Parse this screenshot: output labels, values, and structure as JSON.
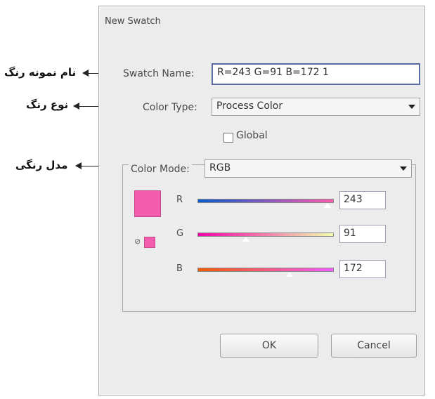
{
  "dialog": {
    "title": "New Swatch",
    "swatch_name_label": "Swatch Name:",
    "swatch_name_value": "R=243 G=91 B=172 1",
    "color_type_label": "Color Type:",
    "color_type_value": "Process Color",
    "global_label": "Global",
    "global_checked": false,
    "color_mode_label": "Color Mode:",
    "color_mode_value": "RGB",
    "swatch_color": "#f35bac",
    "sliders": [
      {
        "label": "R",
        "value": "243",
        "fraction": 0.953
      },
      {
        "label": "G",
        "value": "91",
        "fraction": 0.357
      },
      {
        "label": "B",
        "value": "172",
        "fraction": 0.675
      }
    ],
    "ok_label": "OK",
    "cancel_label": "Cancel"
  },
  "annotations": {
    "swatch_name": "نام نمونه رنگ",
    "color_type": "نوع رنگ",
    "color_mode": "مدل رنگی"
  }
}
